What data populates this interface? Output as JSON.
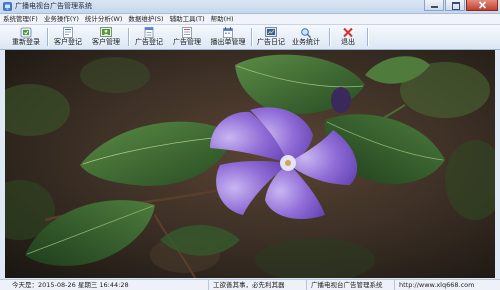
{
  "window": {
    "title": "广播电视台广告管理系统"
  },
  "menubar": [
    "系统管理(F)",
    "业务操作(Y)",
    "统计分析(W)",
    "数据维护(S)",
    "辅助工具(T)",
    "帮助(H)"
  ],
  "toolbar": {
    "relogin": "重新登录",
    "customer_register": "客户登记",
    "customer_manage": "客户管理",
    "ad_register": "广告登记",
    "ad_manage": "广告管理",
    "schedule_manage": "播出单管理",
    "ad_log": "广告日记",
    "business_stats": "业务统计",
    "exit": "退出"
  },
  "main": {
    "image": "periwinkle-flower-wallpaper"
  },
  "status": {
    "date": "今天是：2015-08-26 星期三 16:44:28",
    "motto": "工欲善其事，必先利其器",
    "product": "广播电视台广告管理系统",
    "url": "http://www.xlq668.com"
  },
  "colors": {
    "titlebar": "#c5d6ec",
    "close_button": "#c0402d",
    "petal": "#8f6bd6",
    "leaf": "#3d6b34"
  }
}
